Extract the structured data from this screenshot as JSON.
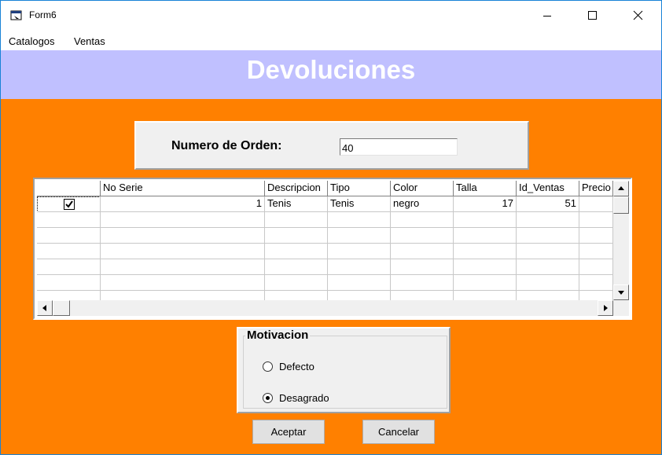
{
  "window": {
    "title": "Form6",
    "icon": "form-window-icon"
  },
  "menu": {
    "items": [
      {
        "label": "Catalogos"
      },
      {
        "label": "Ventas"
      }
    ]
  },
  "header": {
    "title": "Devoluciones"
  },
  "order": {
    "label": "Numero de Orden:",
    "value": "40"
  },
  "grid": {
    "columns": [
      "",
      "No Serie",
      "Descripcion",
      "Tipo",
      "Color",
      "Talla",
      "Id_Ventas",
      "Precio"
    ],
    "rows": [
      {
        "checked": true,
        "no_serie": "1",
        "descripcion": "Tenis",
        "tipo": "Tenis",
        "color": "negro",
        "talla": "17",
        "id_ventas": "51",
        "precio": ""
      }
    ]
  },
  "motivacion": {
    "legend": "Motivacion",
    "options": [
      {
        "label": "Defecto",
        "selected": false
      },
      {
        "label": "Desagrado",
        "selected": true
      }
    ]
  },
  "buttons": {
    "accept": "Aceptar",
    "cancel": "Cancelar"
  },
  "colors": {
    "background": "#ff8000",
    "header_band": "#c0c0ff",
    "header_text": "#ffffff",
    "panel": "#f0f0f0"
  }
}
